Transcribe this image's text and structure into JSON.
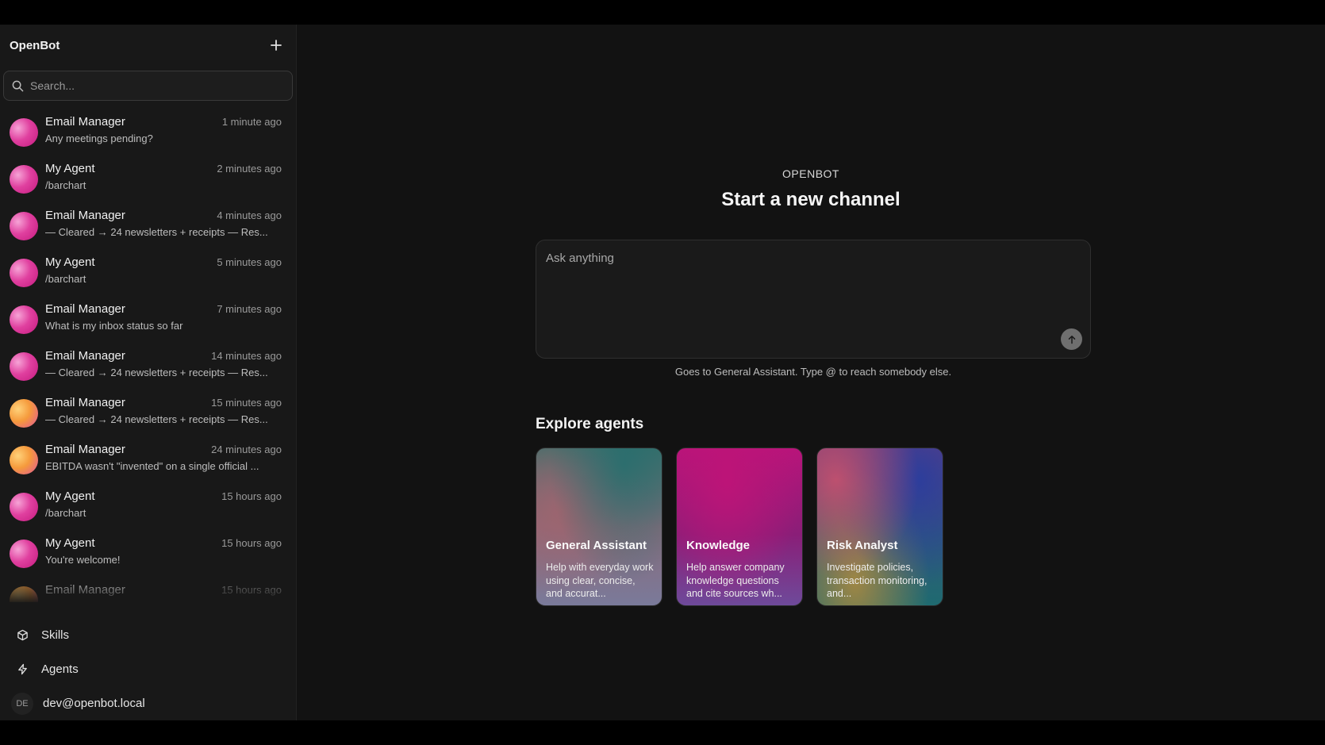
{
  "app": {
    "title": "OpenBot"
  },
  "search": {
    "placeholder": "Search..."
  },
  "conversations": [
    {
      "name": "Email Manager",
      "time": "1 minute ago",
      "preview": "Any meetings pending?",
      "avatar": "pink"
    },
    {
      "name": "My Agent",
      "time": "2 minutes ago",
      "preview": "/barchart",
      "avatar": "pink"
    },
    {
      "name": "Email Manager",
      "time": "4 minutes ago",
      "preview": "— Cleared → 24 newsletters + receipts — Res...",
      "avatar": "pink"
    },
    {
      "name": "My Agent",
      "time": "5 minutes ago",
      "preview": "/barchart",
      "avatar": "pink"
    },
    {
      "name": "Email Manager",
      "time": "7 minutes ago",
      "preview": "What is my inbox status so far",
      "avatar": "pink"
    },
    {
      "name": "Email Manager",
      "time": "14 minutes ago",
      "preview": "— Cleared → 24 newsletters + receipts — Res...",
      "avatar": "pink"
    },
    {
      "name": "Email Manager",
      "time": "15 minutes ago",
      "preview": "— Cleared → 24 newsletters + receipts — Res...",
      "avatar": "orange"
    },
    {
      "name": "Email Manager",
      "time": "24 minutes ago",
      "preview": "EBITDA wasn't \"invented\" on a single official ...",
      "avatar": "orange"
    },
    {
      "name": "My Agent",
      "time": "15 hours ago",
      "preview": "/barchart",
      "avatar": "pink"
    },
    {
      "name": "My Agent",
      "time": "15 hours ago",
      "preview": "You're welcome!",
      "avatar": "pink"
    },
    {
      "name": "Email Manager",
      "time": "15 hours ago",
      "preview": "",
      "avatar": "orange"
    }
  ],
  "nav": {
    "skills": "Skills",
    "agents": "Agents"
  },
  "user": {
    "initials": "DE",
    "email": "dev@openbot.local"
  },
  "main": {
    "eyebrow": "OPENBOT",
    "title": "Start a new channel",
    "composer_placeholder": "Ask anything",
    "hint": "Goes to General Assistant. Type @ to reach somebody else.",
    "explore_title": "Explore agents"
  },
  "agents": [
    {
      "name": "General Assistant",
      "desc": "Help with everyday work using clear, concise, and accurat..."
    },
    {
      "name": "Knowledge",
      "desc": "Help answer company knowledge questions and cite sources wh..."
    },
    {
      "name": "Risk Analyst",
      "desc": "Investigate policies, transaction monitoring, and..."
    }
  ]
}
